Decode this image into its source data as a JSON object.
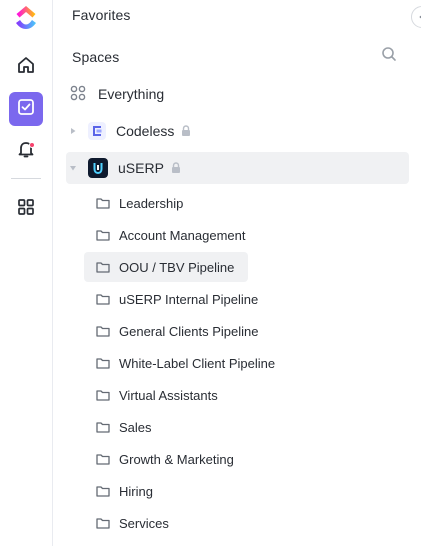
{
  "sidebar": {
    "favorites_label": "Favorites",
    "spaces_label": "Spaces",
    "everything_label": "Everything",
    "spaces": [
      {
        "name": "Codeless",
        "locked": true,
        "expanded": false
      },
      {
        "name": "uSERP",
        "locked": true,
        "expanded": true
      }
    ],
    "folders": [
      {
        "label": "Leadership"
      },
      {
        "label": "Account Management"
      },
      {
        "label": "OOU / TBV Pipeline",
        "active": true
      },
      {
        "label": "uSERP Internal Pipeline"
      },
      {
        "label": "General Clients Pipeline"
      },
      {
        "label": "White-Label Client Pipeline"
      },
      {
        "label": "Virtual Assistants"
      },
      {
        "label": "Sales"
      },
      {
        "label": "Growth & Marketing"
      },
      {
        "label": "Hiring"
      },
      {
        "label": "Services"
      }
    ]
  },
  "rail": {
    "items": [
      "home-icon",
      "tasks-icon",
      "notifications-icon",
      "apps-icon"
    ]
  },
  "colors": {
    "accent": "#7b68ee",
    "notif_dot": "#f6416c",
    "text": "#292d34",
    "icon": "#7c828d",
    "active_bg": "#f0f1f3"
  }
}
